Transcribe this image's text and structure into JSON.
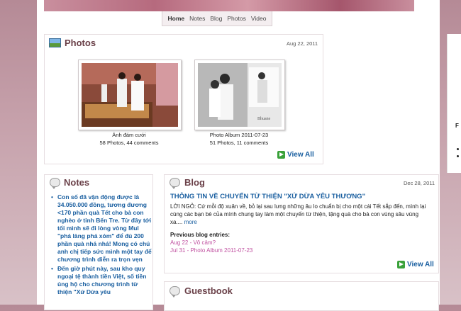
{
  "nav": {
    "items": [
      "Home",
      "Notes",
      "Blog",
      "Photos",
      "Video"
    ]
  },
  "photos": {
    "title": "Photos",
    "date": "Aug 22, 2011",
    "albums": [
      {
        "name": "Ảnh đám cưới",
        "stats": "58 Photos, 44 comments"
      },
      {
        "name": "Photo Album 2011-07-23",
        "stats": "51 Photos, 11 comments"
      }
    ],
    "view_all": "View All"
  },
  "notes": {
    "title": "Notes",
    "items": [
      "Con số đã vận động được là 34.050.000 đồng, tương đương <170 phần quà Tết cho bà con nghèo ở tỉnh Bến Tre. Từ đây tới tối mình sẽ đi lòng vòng Mul \"phá làng phá xóm\" để đủ 200 phần quà nhá nhá! Mong có chú anh chị tiếp sức mình một tay để chương trình diễn ra trọn vẹn",
      "Đến giờ phút này, sau kho quy ngoại tệ thành tiền Việt, số tiền ủng hộ cho chương trình từ thiện \"Xứ Dừa yêu"
    ]
  },
  "blog": {
    "title": "Blog",
    "date": "Dec 28, 2011",
    "post_title": "THÔNG TIN VỀ CHUYẾN TỪ THIỆN \"XỨ DỪA YÊU THƯƠNG\"",
    "excerpt": "LỜI NGỎ:  Cứ mỗi độ xuân về, bỏ lại sau lưng những âu lo chuẩn bị cho một cái Tết sắp đến, mình lại cùng các bạn bè của mình chung tay làm một chuyến từ thiện, tặng quà cho bà con vùng sâu vùng xa....",
    "more": "more",
    "previous_label": "Previous blog entries:",
    "previous": [
      {
        "date": "Aug 22",
        "title": "Vô cảm?"
      },
      {
        "date": "Jul 31",
        "title": "Photo Album 2011-07-23"
      }
    ],
    "view_all": "View All"
  },
  "guestbook": {
    "title": "Guestbook"
  },
  "sidebar": {
    "letter": "F"
  }
}
